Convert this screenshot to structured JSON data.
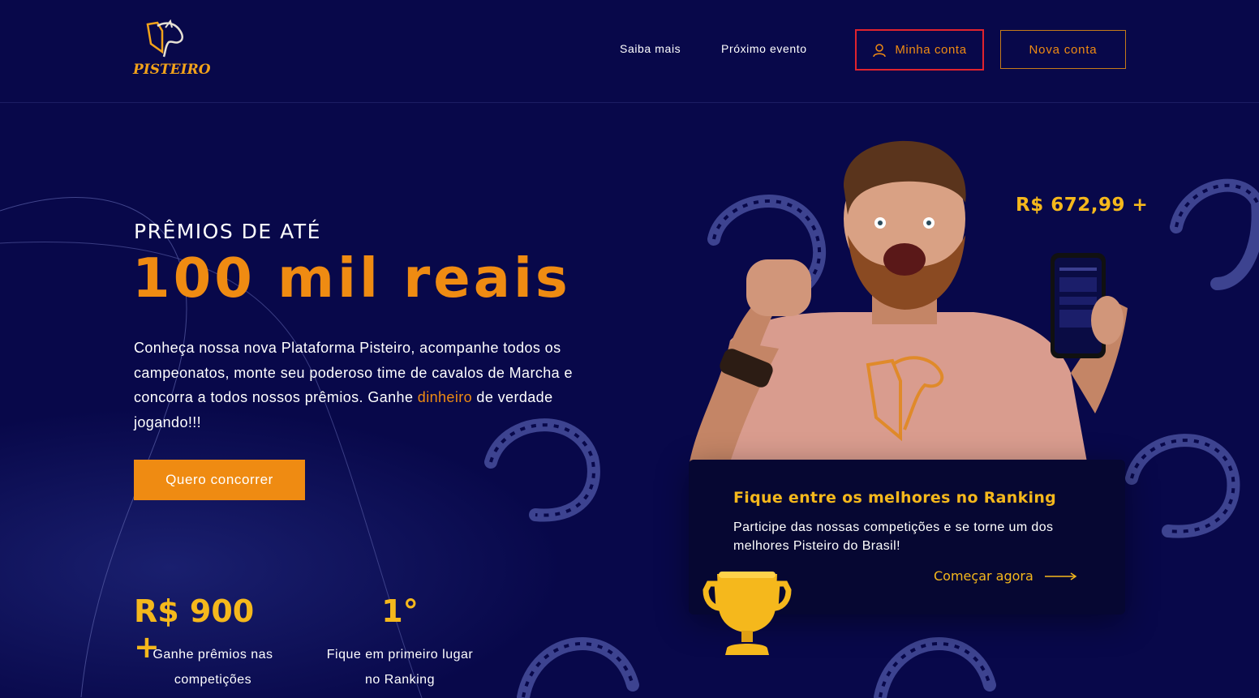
{
  "header": {
    "logo_text": "PISTEIRO",
    "nav": [
      "Saiba mais",
      "Próximo evento"
    ],
    "account_label": "Minha conta",
    "new_account_label": "Nova conta"
  },
  "hero": {
    "subtitle": "PRÊMIOS DE ATÉ",
    "title": "100 mil reais",
    "text_before": "Conheça nossa nova Plataforma Pisteiro, acompanhe todos os campeonatos, monte seu poderoso time de cavalos de Marcha e concorra a todos nossos prêmios. Ganhe ",
    "text_highlight": "dinheiro",
    "text_after": " de verdade jogando!!!",
    "cta": "Quero concorrer"
  },
  "stats": [
    {
      "value": "R$ 900 +",
      "label_line1": "Ganhe prêmios nas",
      "label_line2": "competições"
    },
    {
      "value": "1°",
      "label_line1": "Fique em primeiro lugar",
      "label_line2": "no Ranking"
    }
  ],
  "prize_badge": "R$  672,99 +",
  "ranking_card": {
    "title": "Fique entre os melhores no Ranking",
    "text": "Participe das nossas competições e se torne um dos melhores Pisteiro do Brasil!",
    "link": "Começar agora"
  },
  "colors": {
    "background": "#08084a",
    "accent_orange": "#ef8b12",
    "accent_yellow": "#f5b81c",
    "highlight_border": "#e0232e"
  },
  "icons": [
    "horse-logo-icon",
    "user-icon",
    "arrow-right-icon",
    "trophy-icon",
    "horseshoe-icon",
    "phone-icon"
  ]
}
